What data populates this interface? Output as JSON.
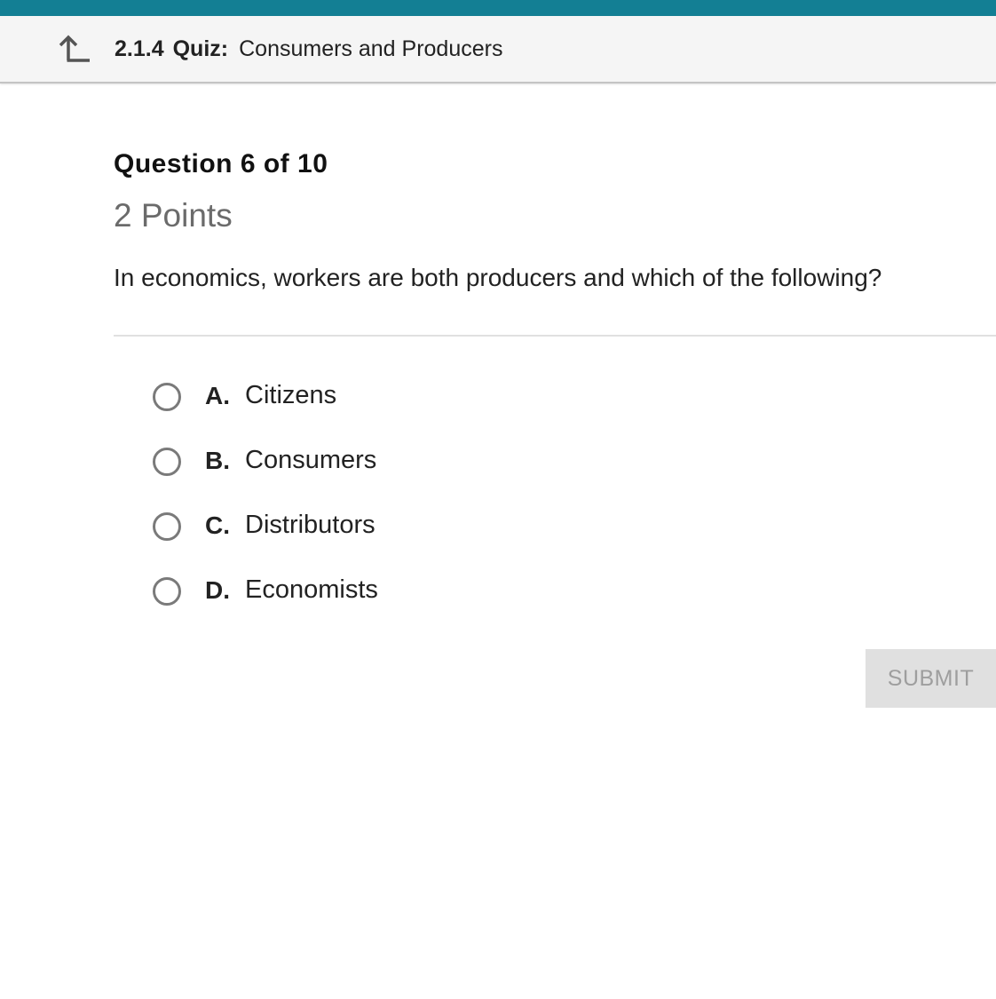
{
  "colors": {
    "accent_bar": "#137f94",
    "header_bg": "#f5f5f5",
    "submit_bg": "#e0e0e0",
    "submit_text": "#9e9e9e"
  },
  "header": {
    "back_icon": "back-arrow-icon",
    "lesson_number": "2.1.4",
    "quiz_label": "Quiz:",
    "lesson_title": "Consumers and Producers"
  },
  "question": {
    "number_label": "Question 6 of 10",
    "points_label": "2 Points",
    "prompt": "In economics, workers are both producers and which of the following?"
  },
  "choices": [
    {
      "letter": "A.",
      "text": "Citizens",
      "selected": false
    },
    {
      "letter": "B.",
      "text": "Consumers",
      "selected": false
    },
    {
      "letter": "C.",
      "text": "Distributors",
      "selected": false
    },
    {
      "letter": "D.",
      "text": "Economists",
      "selected": false
    }
  ],
  "submit": {
    "label": "SUBMIT",
    "enabled": false
  }
}
